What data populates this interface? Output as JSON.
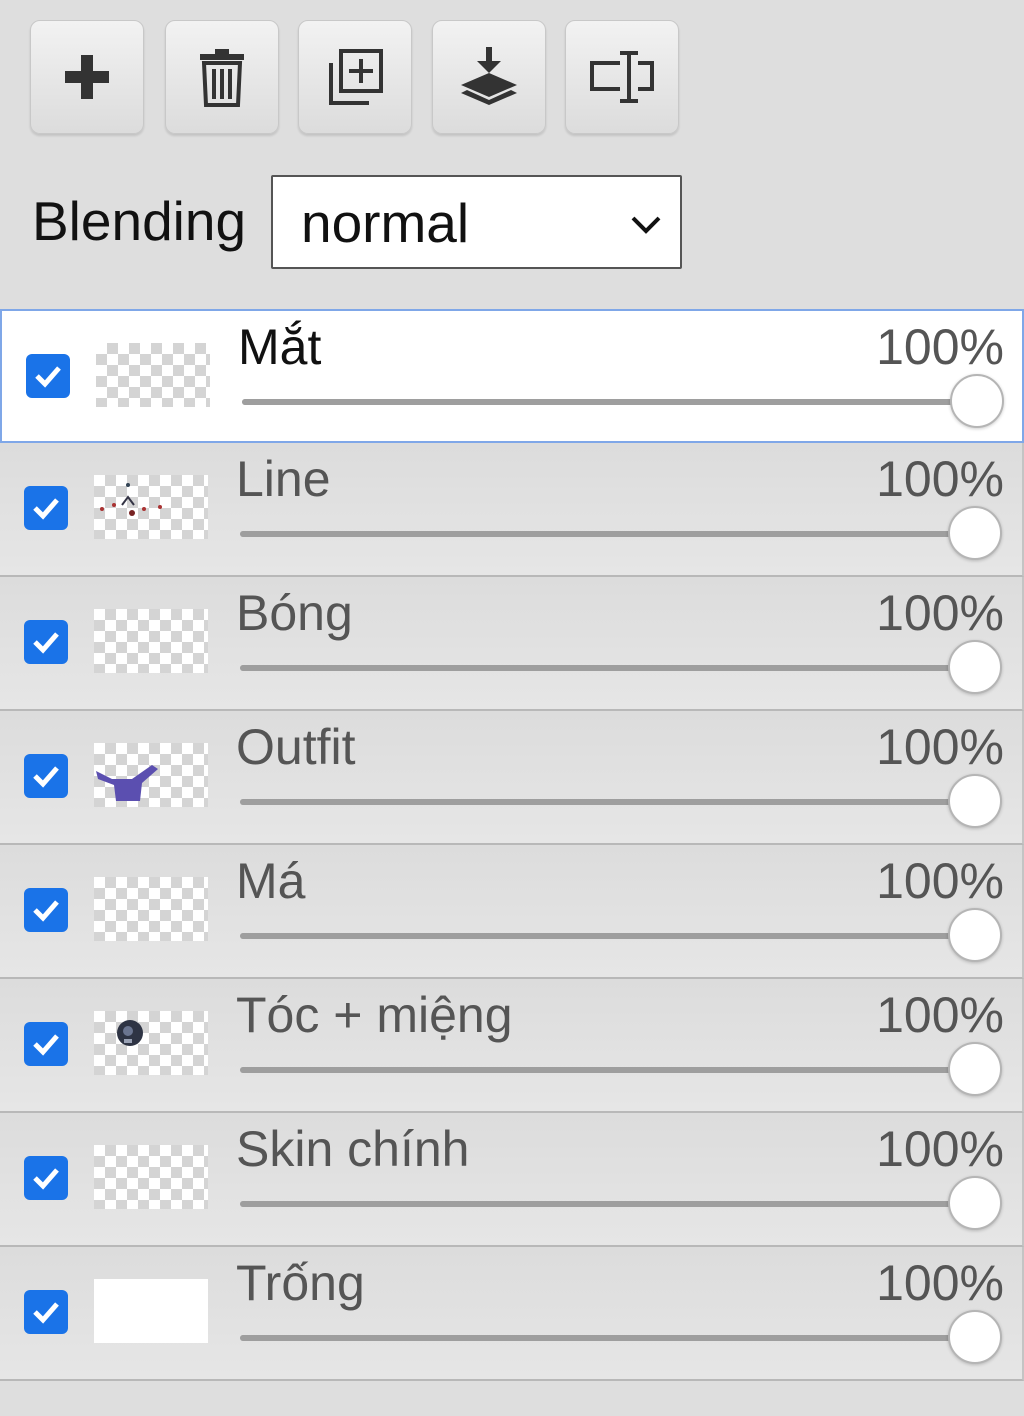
{
  "toolbar": {
    "buttons": [
      {
        "name": "add-layer-button",
        "icon": "plus-icon"
      },
      {
        "name": "delete-layer-button",
        "icon": "trash-icon"
      },
      {
        "name": "duplicate-layer-button",
        "icon": "duplicate-icon"
      },
      {
        "name": "merge-down-button",
        "icon": "merge-down-icon"
      },
      {
        "name": "rename-layer-button",
        "icon": "text-cursor-icon"
      }
    ]
  },
  "blending": {
    "label": "Blending",
    "value": "normal"
  },
  "colors": {
    "accent": "#1a73e8",
    "active_border": "#7fa7e8",
    "panel_bg": "#dedede"
  },
  "layers": [
    {
      "name": "Mắt",
      "opacity_label": "100%",
      "opacity": 1.0,
      "visible": true,
      "active": true,
      "thumb": "transparent"
    },
    {
      "name": "Line",
      "opacity_label": "100%",
      "opacity": 1.0,
      "visible": true,
      "active": false,
      "thumb": "line-sketch"
    },
    {
      "name": "Bóng",
      "opacity_label": "100%",
      "opacity": 1.0,
      "visible": true,
      "active": false,
      "thumb": "transparent"
    },
    {
      "name": "Outfit",
      "opacity_label": "100%",
      "opacity": 1.0,
      "visible": true,
      "active": false,
      "thumb": "purple-outfit"
    },
    {
      "name": "Má",
      "opacity_label": "100%",
      "opacity": 1.0,
      "visible": true,
      "active": false,
      "thumb": "transparent"
    },
    {
      "name": "Tóc + miệng",
      "opacity_label": "100%",
      "opacity": 1.0,
      "visible": true,
      "active": false,
      "thumb": "dark-hair"
    },
    {
      "name": "Skin chính",
      "opacity_label": "100%",
      "opacity": 1.0,
      "visible": true,
      "active": false,
      "thumb": "transparent"
    },
    {
      "name": "Trống",
      "opacity_label": "100%",
      "opacity": 1.0,
      "visible": true,
      "active": false,
      "thumb": "white"
    }
  ]
}
